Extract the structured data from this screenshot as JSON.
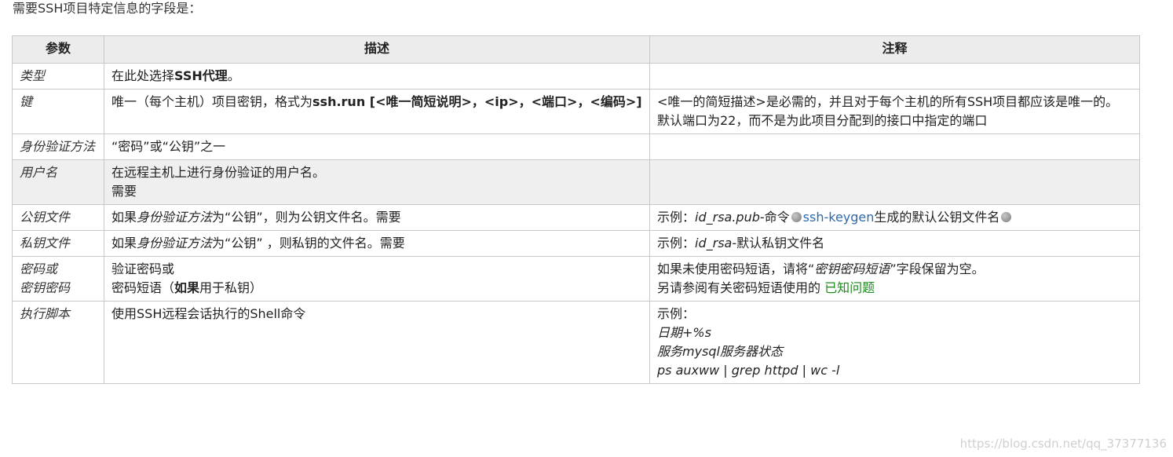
{
  "intro": "需要SSH项目特定信息的字段是：",
  "headers": {
    "param": "参数",
    "desc": "描述",
    "note": "注释"
  },
  "rows": {
    "type": {
      "name": "类型",
      "desc_a": "在此处选择",
      "desc_b": "SSH代理",
      "desc_c": "。",
      "note": ""
    },
    "key": {
      "name": "键",
      "desc_a": "唯一（每个主机）项目密钥，格式为",
      "desc_b": "ssh.run [<唯一简短说明>，<ip>，<端口>，<编码>]",
      "note_1": "<唯一的简短描述>是必需的，并且对于每个主机的所有SSH项目都应该是唯一的。",
      "note_2": "默认端口为22，而不是为此项目分配到的接口中指定的端口"
    },
    "auth": {
      "name": "身份验证方法",
      "desc": "“密码”或“公钥”之一",
      "note": ""
    },
    "user": {
      "name": "用户名",
      "desc_1": "在远程主机上进行身份验证的用户名。",
      "desc_2": "需要",
      "note": ""
    },
    "pubkey": {
      "name": "公钥文件",
      "desc_a": "如果",
      "desc_b": "身份验证方法",
      "desc_c": "为“公钥”，则为公钥文件名。需要",
      "note_a": "示例：",
      "note_b": "id_rsa.pub",
      "note_c": "-命令",
      "note_link": "ssh-keygen",
      "note_d": "生成的默认公钥文件名"
    },
    "privkey": {
      "name": "私钥文件",
      "desc_a": "如果",
      "desc_b": "身份验证方法",
      "desc_c": "为“公钥” ，则私钥的文件名。需要",
      "note_a": "示例：",
      "note_b": "id_rsa",
      "note_c": "-默认私钥文件名"
    },
    "password": {
      "name_1": "密码或",
      "name_2": "密钥密码",
      "desc_1": "验证密码或",
      "desc_2a": "密码短语（",
      "desc_2b": "如果",
      "desc_2c": "用于私钥）",
      "note_1a": "如果未使用密码短语，请将“",
      "note_1b": "密钥密码短语",
      "note_1c": "”字段保留为空。",
      "note_2a": "另请参阅有关密码短语使用的",
      "note_2b": "已知问题"
    },
    "script": {
      "name": "执行脚本",
      "desc": "使用SSH远程会话执行的Shell命令",
      "note_1": "示例：",
      "note_2": "日期+%s",
      "note_3": "服务mysql服务器状态",
      "note_4": "ps auxww | grep httpd | wc -l"
    }
  },
  "watermark": "https://blog.csdn.net/qq_37377136"
}
